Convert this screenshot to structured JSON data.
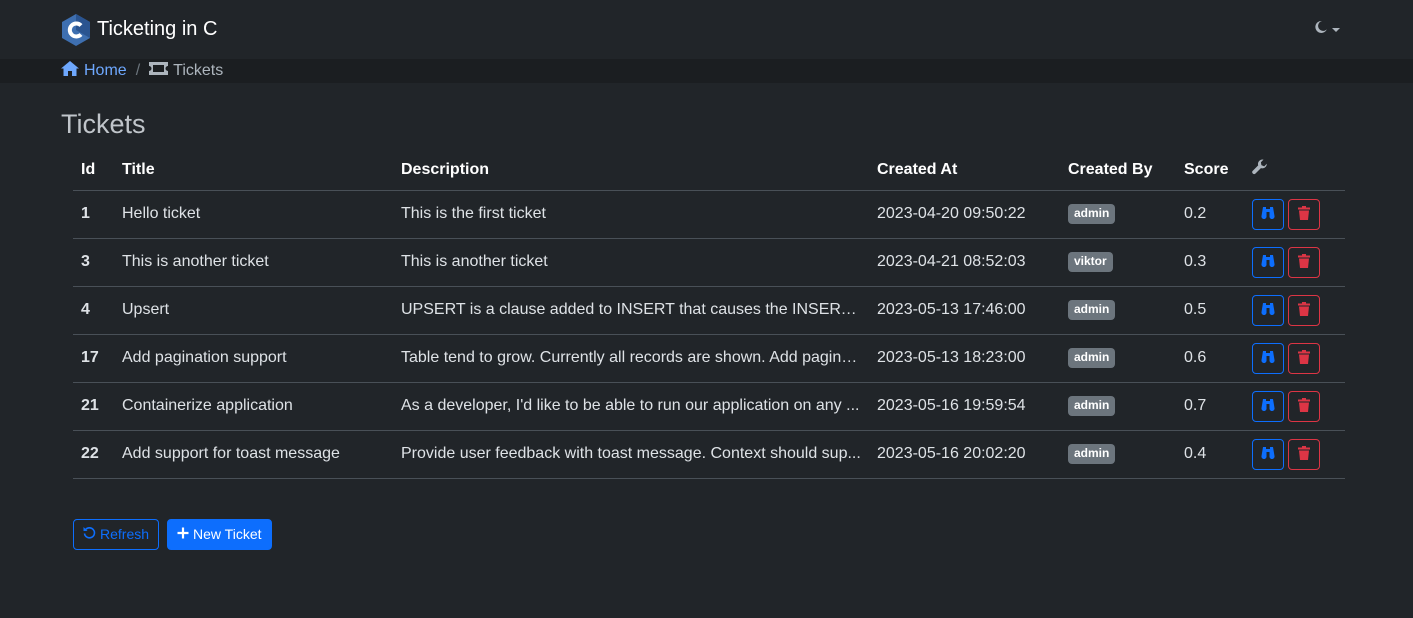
{
  "navbar": {
    "brand": "Ticketing in C"
  },
  "breadcrumb": {
    "home": "Home",
    "current": "Tickets"
  },
  "page": {
    "title": "Tickets"
  },
  "table": {
    "headers": {
      "id": "Id",
      "title": "Title",
      "description": "Description",
      "created_at": "Created At",
      "created_by": "Created By",
      "score": "Score"
    },
    "rows": [
      {
        "id": "1",
        "title": "Hello ticket",
        "description": "This is the first ticket",
        "created_at": "2023-04-20 09:50:22",
        "created_by": "admin",
        "score": "0.2"
      },
      {
        "id": "3",
        "title": "This is another ticket",
        "description": "This is another ticket",
        "created_at": "2023-04-21 08:52:03",
        "created_by": "viktor",
        "score": "0.3"
      },
      {
        "id": "4",
        "title": "Upsert",
        "description": "UPSERT is a clause added to INSERT that causes the INSERT to ...",
        "created_at": "2023-05-13 17:46:00",
        "created_by": "admin",
        "score": "0.5"
      },
      {
        "id": "17",
        "title": "Add pagination support",
        "description": "Table tend to grow. Currently all records are shown. Add pagina...",
        "created_at": "2023-05-13 18:23:00",
        "created_by": "admin",
        "score": "0.6"
      },
      {
        "id": "21",
        "title": "Containerize application",
        "description": "As a developer, I'd like to be able to run our application on any ...",
        "created_at": "2023-05-16 19:59:54",
        "created_by": "admin",
        "score": "0.7"
      },
      {
        "id": "22",
        "title": "Add support for toast message",
        "description": "Provide user feedback with toast message. Context should sup...",
        "created_at": "2023-05-16 20:02:20",
        "created_by": "admin",
        "score": "0.4"
      }
    ]
  },
  "buttons": {
    "refresh": "Refresh",
    "new_ticket": "New Ticket"
  },
  "colors": {
    "primary": "#0d6efd",
    "danger": "#dc3545",
    "badge": "#6c757d",
    "background": "#212529"
  }
}
